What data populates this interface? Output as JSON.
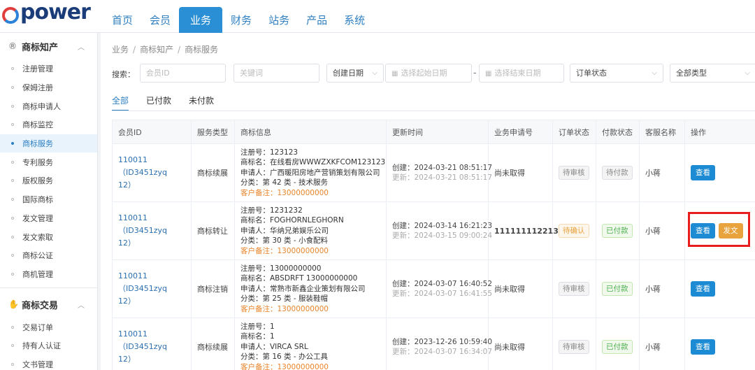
{
  "brand": {
    "logo_text": "power"
  },
  "nav": [
    "首页",
    "会员",
    "业务",
    "财务",
    "站务",
    "产品",
    "系统"
  ],
  "nav_active": 2,
  "sidebar": {
    "groups": [
      {
        "icon": "registered-icon",
        "icon_glyph": "®",
        "label": "商标知产",
        "items": [
          "注册管理",
          "保姆注册",
          "商标申请人",
          "商标监控",
          "商标服务",
          "专利服务",
          "版权服务",
          "国际商标",
          "发文管理",
          "发文索取",
          "商标公证",
          "商机管理"
        ],
        "active_item": 4
      },
      {
        "icon": "handshake-icon",
        "icon_glyph": "✋",
        "label": "商标交易",
        "items": [
          "交易订单",
          "持有人认证",
          "文书管理"
        ]
      }
    ]
  },
  "breadcrumb": [
    "业务",
    "商标知产",
    "商标服务"
  ],
  "filters": {
    "label": "搜索：",
    "member_id_placeholder": "会员ID",
    "keyword_placeholder": "关键词",
    "date_type": "创建日期",
    "start_placeholder": "选择起始日期",
    "dash": "-",
    "end_placeholder": "选择结束日期",
    "order_status": "订单状态",
    "type": "全部类型"
  },
  "tabs": [
    "全部",
    "已付款",
    "未付款"
  ],
  "tab_active": 0,
  "table": {
    "headers": [
      "会员ID",
      "服务类型",
      "商标信息",
      "更新时间",
      "业务申请号",
      "订单状态",
      "付款状态",
      "客服名称",
      "操作"
    ],
    "rows": [
      {
        "member_line1": "110011（ID3451zyq",
        "member_line2": "12）",
        "service": "商标续展",
        "reg_no": "注册号：123123",
        "mark_name": "商标名：在线看房WWWZXKFCOM123123",
        "applicant": "申请人：广西暖阳房地产营销策划有限公司",
        "category": "分类：第 42 类 - 技术服务",
        "remark": "客户备注：13000000000",
        "created": "创建：2024-03-21 08:51:17",
        "updated": "更新：2024-03-21 08:51:17",
        "app_no": "尚未取得",
        "app_no_style": "pending",
        "order_status": "待审核",
        "order_style": "gray",
        "pay_status": "待付款",
        "pay_style": "gray",
        "agent": "小蒋",
        "actions": [
          "查看"
        ]
      },
      {
        "member_line1": "110011（ID3451zyq",
        "member_line2": "12）",
        "service": "商标转让",
        "reg_no": "注册号：1231232",
        "mark_name": "商标名：FOGHORNLEGHORN",
        "applicant": "申请人：华纳兄弟娱乐公司",
        "category": "分类：第 30 类 - 小食配料",
        "remark": "客户备注：13000000000",
        "created": "创建：2024-03-14 16:21:23",
        "updated": "更新：2024-03-15 09:00:24",
        "app_no": "111111112213",
        "app_no_style": "green",
        "order_status": "待确认",
        "order_style": "yellow",
        "pay_status": "已付款",
        "pay_style": "green",
        "agent": "小蒋",
        "actions": [
          "查看",
          "发文"
        ]
      },
      {
        "member_line1": "110011（ID3451zyq",
        "member_line2": "12）",
        "service": "商标注销",
        "reg_no": "注册号：13000000000",
        "mark_name": "商标名：ABSDRFT 13000000000",
        "applicant": "申请人：常熟市新鑫企业策划有限公司",
        "category": "分类：第 25 类 - 服装鞋帽",
        "remark": "客户备注：13000000000",
        "created": "创建：2024-03-07 16:40:52",
        "updated": "更新：2024-03-07 16:41:55",
        "app_no": "尚未取得",
        "app_no_style": "pending",
        "order_status": "待审核",
        "order_style": "gray",
        "pay_status": "已付款",
        "pay_style": "green",
        "agent": "小蒋",
        "actions": [
          "查看"
        ]
      },
      {
        "member_line1": "110011（ID3451zyq",
        "member_line2": "12）",
        "service": "商标续展",
        "reg_no": "注册号：1",
        "mark_name": "商标名：1",
        "applicant": "申请人：VIRCA SRL",
        "category": "分类：第 16 类 - 办公工具",
        "remark": "客户备注：13000000000",
        "created": "创建：2023-12-26 10:59:40",
        "updated": "更新：2024-03-07 16:34:07",
        "app_no": "尚未取得",
        "app_no_style": "pending",
        "order_status": "待审核",
        "order_style": "gray",
        "pay_status": "已付款",
        "pay_style": "green",
        "agent": "小蒋",
        "actions": [
          "查看"
        ]
      }
    ]
  },
  "colors": {
    "accent": "#2b8fd6",
    "highlight_box": "#e81e1e",
    "remark": "#e8842a",
    "green": "#1aa34a",
    "orange_button": "#e8a33d"
  }
}
